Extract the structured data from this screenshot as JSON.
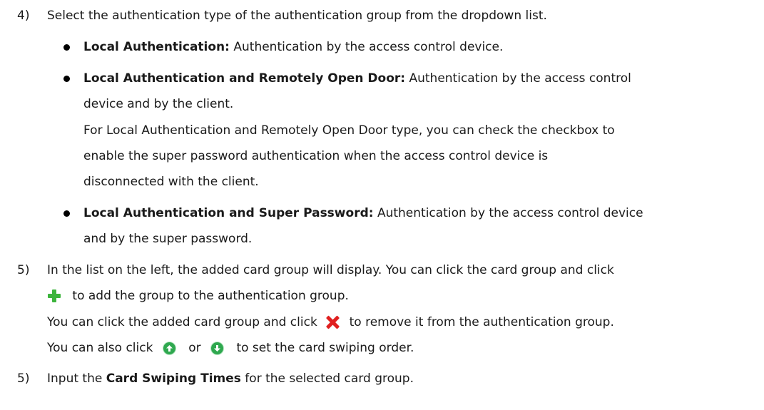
{
  "steps": {
    "step4": {
      "number": "4)",
      "text": "Select the authentication type of the authentication group from the dropdown list."
    },
    "bullet1": {
      "bold": "Local Authentication:",
      "text": " Authentication by the access control device."
    },
    "bullet2": {
      "bold": "Local Authentication and Remotely Open Door:",
      "text": " Authentication by the access control",
      "cont1": "device and by the client.",
      "para1": "For Local Authentication and Remotely Open Door type, you can check the checkbox to",
      "para2": "enable the super password authentication when the access control device is",
      "para3": "disconnected with the client."
    },
    "bullet3": {
      "bold": "Local Authentication and Super Password:",
      "text": " Authentication by the access control device",
      "cont1": "and by the super password."
    },
    "step5a": {
      "number": "5)",
      "line1": "In the list on the left, the added card group will display. You can click the card group and click",
      "line2": "to add the group to the authentication group.",
      "line3a": "You can click the added card group and click",
      "line3b": "to remove it from the authentication group.",
      "line4a": "You can also click",
      "line4b": "or",
      "line4c": "to set the card swiping order."
    },
    "step5b": {
      "number": "5)",
      "text_a": "Input the ",
      "bold": "Card Swiping Times",
      "text_b": " for the selected card group."
    }
  },
  "icons": {
    "add": "plus-icon",
    "remove": "close-icon",
    "up": "arrow-up-circle-icon",
    "down": "arrow-down-circle-icon",
    "add_color": "#3cb43c",
    "remove_color": "#e02020",
    "arrow_color": "#2fa84f"
  }
}
